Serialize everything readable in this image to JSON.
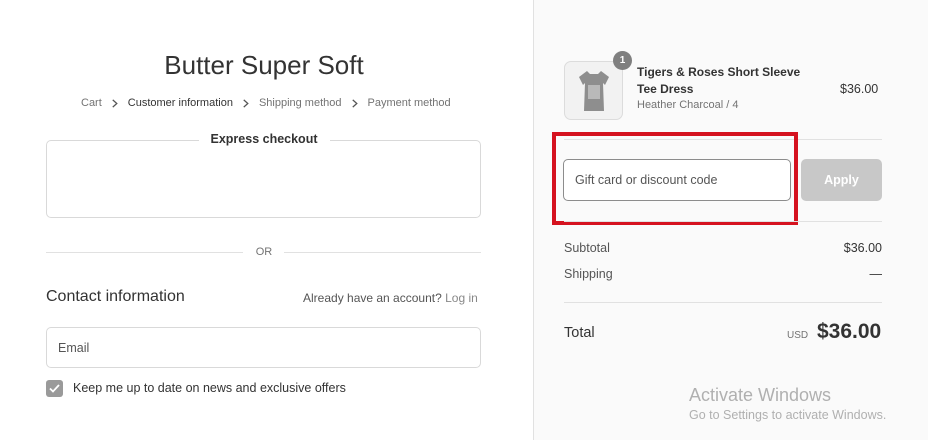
{
  "store": {
    "title": "Butter Super Soft"
  },
  "breadcrumb": {
    "items": [
      {
        "label": "Cart"
      },
      {
        "label": "Customer information"
      },
      {
        "label": "Shipping method"
      },
      {
        "label": "Payment method"
      }
    ]
  },
  "express_checkout": {
    "title": "Express checkout"
  },
  "divider": {
    "or_label": "OR"
  },
  "contact": {
    "heading": "Contact information",
    "account_prompt": "Already have an account?",
    "login_link": "Log in",
    "email_placeholder": "Email",
    "marketing_label": "Keep me up to date on news and exclusive offers",
    "marketing_checked": true
  },
  "order": {
    "item": {
      "quantity": "1",
      "name": "Tigers & Roses Short Sleeve Tee Dress",
      "variant": "Heather Charcoal / 4",
      "price": "$36.00"
    },
    "discount": {
      "placeholder": "Gift card or discount code",
      "apply_label": "Apply"
    },
    "subtotal_label": "Subtotal",
    "subtotal_value": "$36.00",
    "shipping_label": "Shipping",
    "shipping_value": "—",
    "total_label": "Total",
    "currency": "USD",
    "total_value": "$36.00"
  },
  "watermark": {
    "title": "Activate Windows",
    "subtitle": "Go to Settings to activate Windows."
  },
  "colors": {
    "highlight": "#d5121f",
    "apply_disabled": "#c8c8c8",
    "checkbox": "#9a9a9a"
  }
}
